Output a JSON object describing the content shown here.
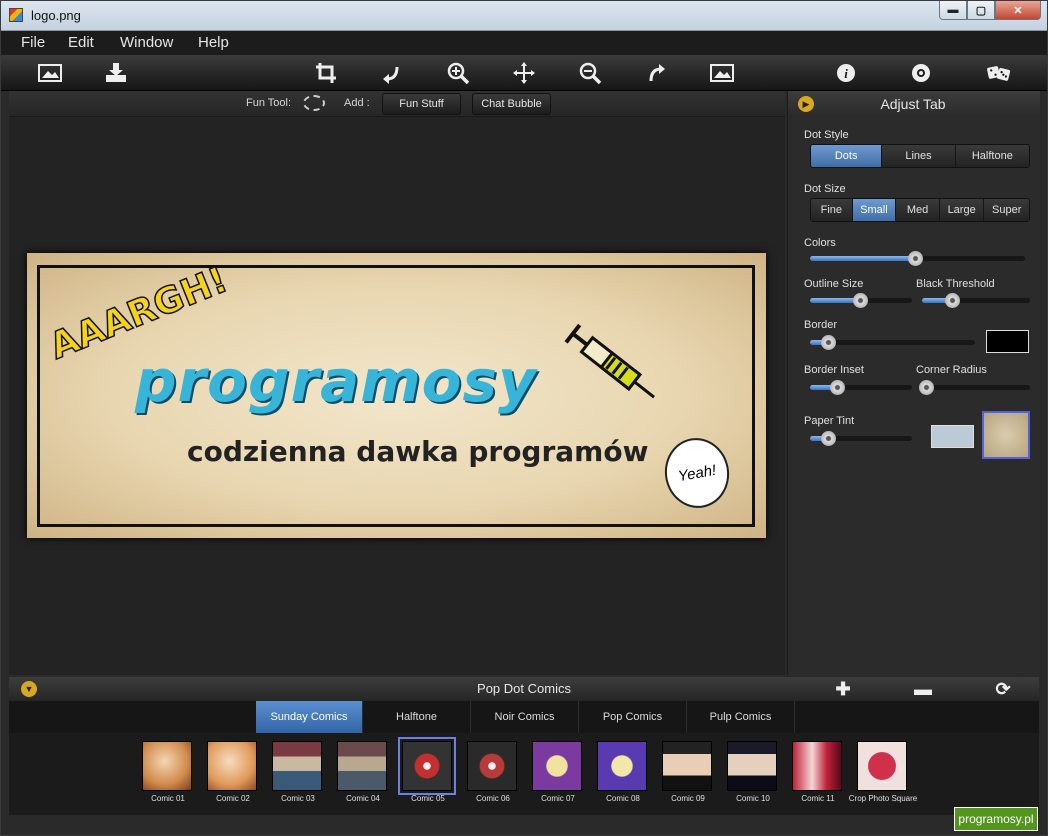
{
  "window": {
    "title": "logo.png",
    "controls": {
      "minimize": "▬",
      "maximize": "▢",
      "close": "✕"
    }
  },
  "menu": [
    "File",
    "Edit",
    "Window",
    "Help"
  ],
  "toolbar": {
    "icons": [
      "photo-open-icon",
      "save-download-icon",
      "crop-icon",
      "rotate-left-icon",
      "zoom-in-icon",
      "move-icon",
      "zoom-out-icon",
      "rotate-right-icon",
      "fit-image-icon",
      "info-icon",
      "settings-icon",
      "random-dice-icon"
    ]
  },
  "funbar": {
    "fun_tool_label": "Fun Tool:",
    "add_label": "Add :",
    "fun_stuff": "Fun Stuff",
    "chat_bubble": "Chat Bubble"
  },
  "image": {
    "shout": "AAARGH!",
    "title": "programosy",
    "subtitle": "codzienna dawka programów",
    "bubble": "Yeah!"
  },
  "adjust": {
    "header": "Adjust Tab",
    "dot_style": {
      "label": "Dot Style",
      "options": [
        "Dots",
        "Lines",
        "Halftone"
      ],
      "selected": "Dots"
    },
    "dot_size": {
      "label": "Dot Size",
      "options": [
        "Fine",
        "Small",
        "Med",
        "Large",
        "Super"
      ],
      "selected": "Small"
    },
    "colors": {
      "label": "Colors",
      "value": 0.49
    },
    "outline_size": {
      "label": "Outline Size",
      "value": 0.49
    },
    "black_threshold": {
      "label": "Black Threshold",
      "value": 0.28
    },
    "border": {
      "label": "Border",
      "value": 0.11,
      "color": "#000000"
    },
    "border_inset": {
      "label": "Border Inset",
      "value": 0.26
    },
    "corner_radius": {
      "label": "Corner Radius",
      "value": 0.0
    },
    "paper_tint": {
      "label": "Paper Tint",
      "value": 0.18,
      "color": "#bcc9d6"
    }
  },
  "presets": {
    "header": "Pop Dot Comics",
    "tabs": [
      "Sunday Comics",
      "Halftone",
      "Noir Comics",
      "Pop Comics",
      "Pulp Comics"
    ],
    "selected_tab": "Sunday Comics",
    "items": [
      "Comic 01",
      "Comic 02",
      "Comic 03",
      "Comic 04",
      "Comic 05",
      "Comic 06",
      "Comic 07",
      "Comic 08",
      "Comic 09",
      "Comic 10",
      "Comic 11",
      "Crop Photo Square"
    ],
    "selected_item": "Comic 05"
  },
  "watermark": "programosy.pl"
}
